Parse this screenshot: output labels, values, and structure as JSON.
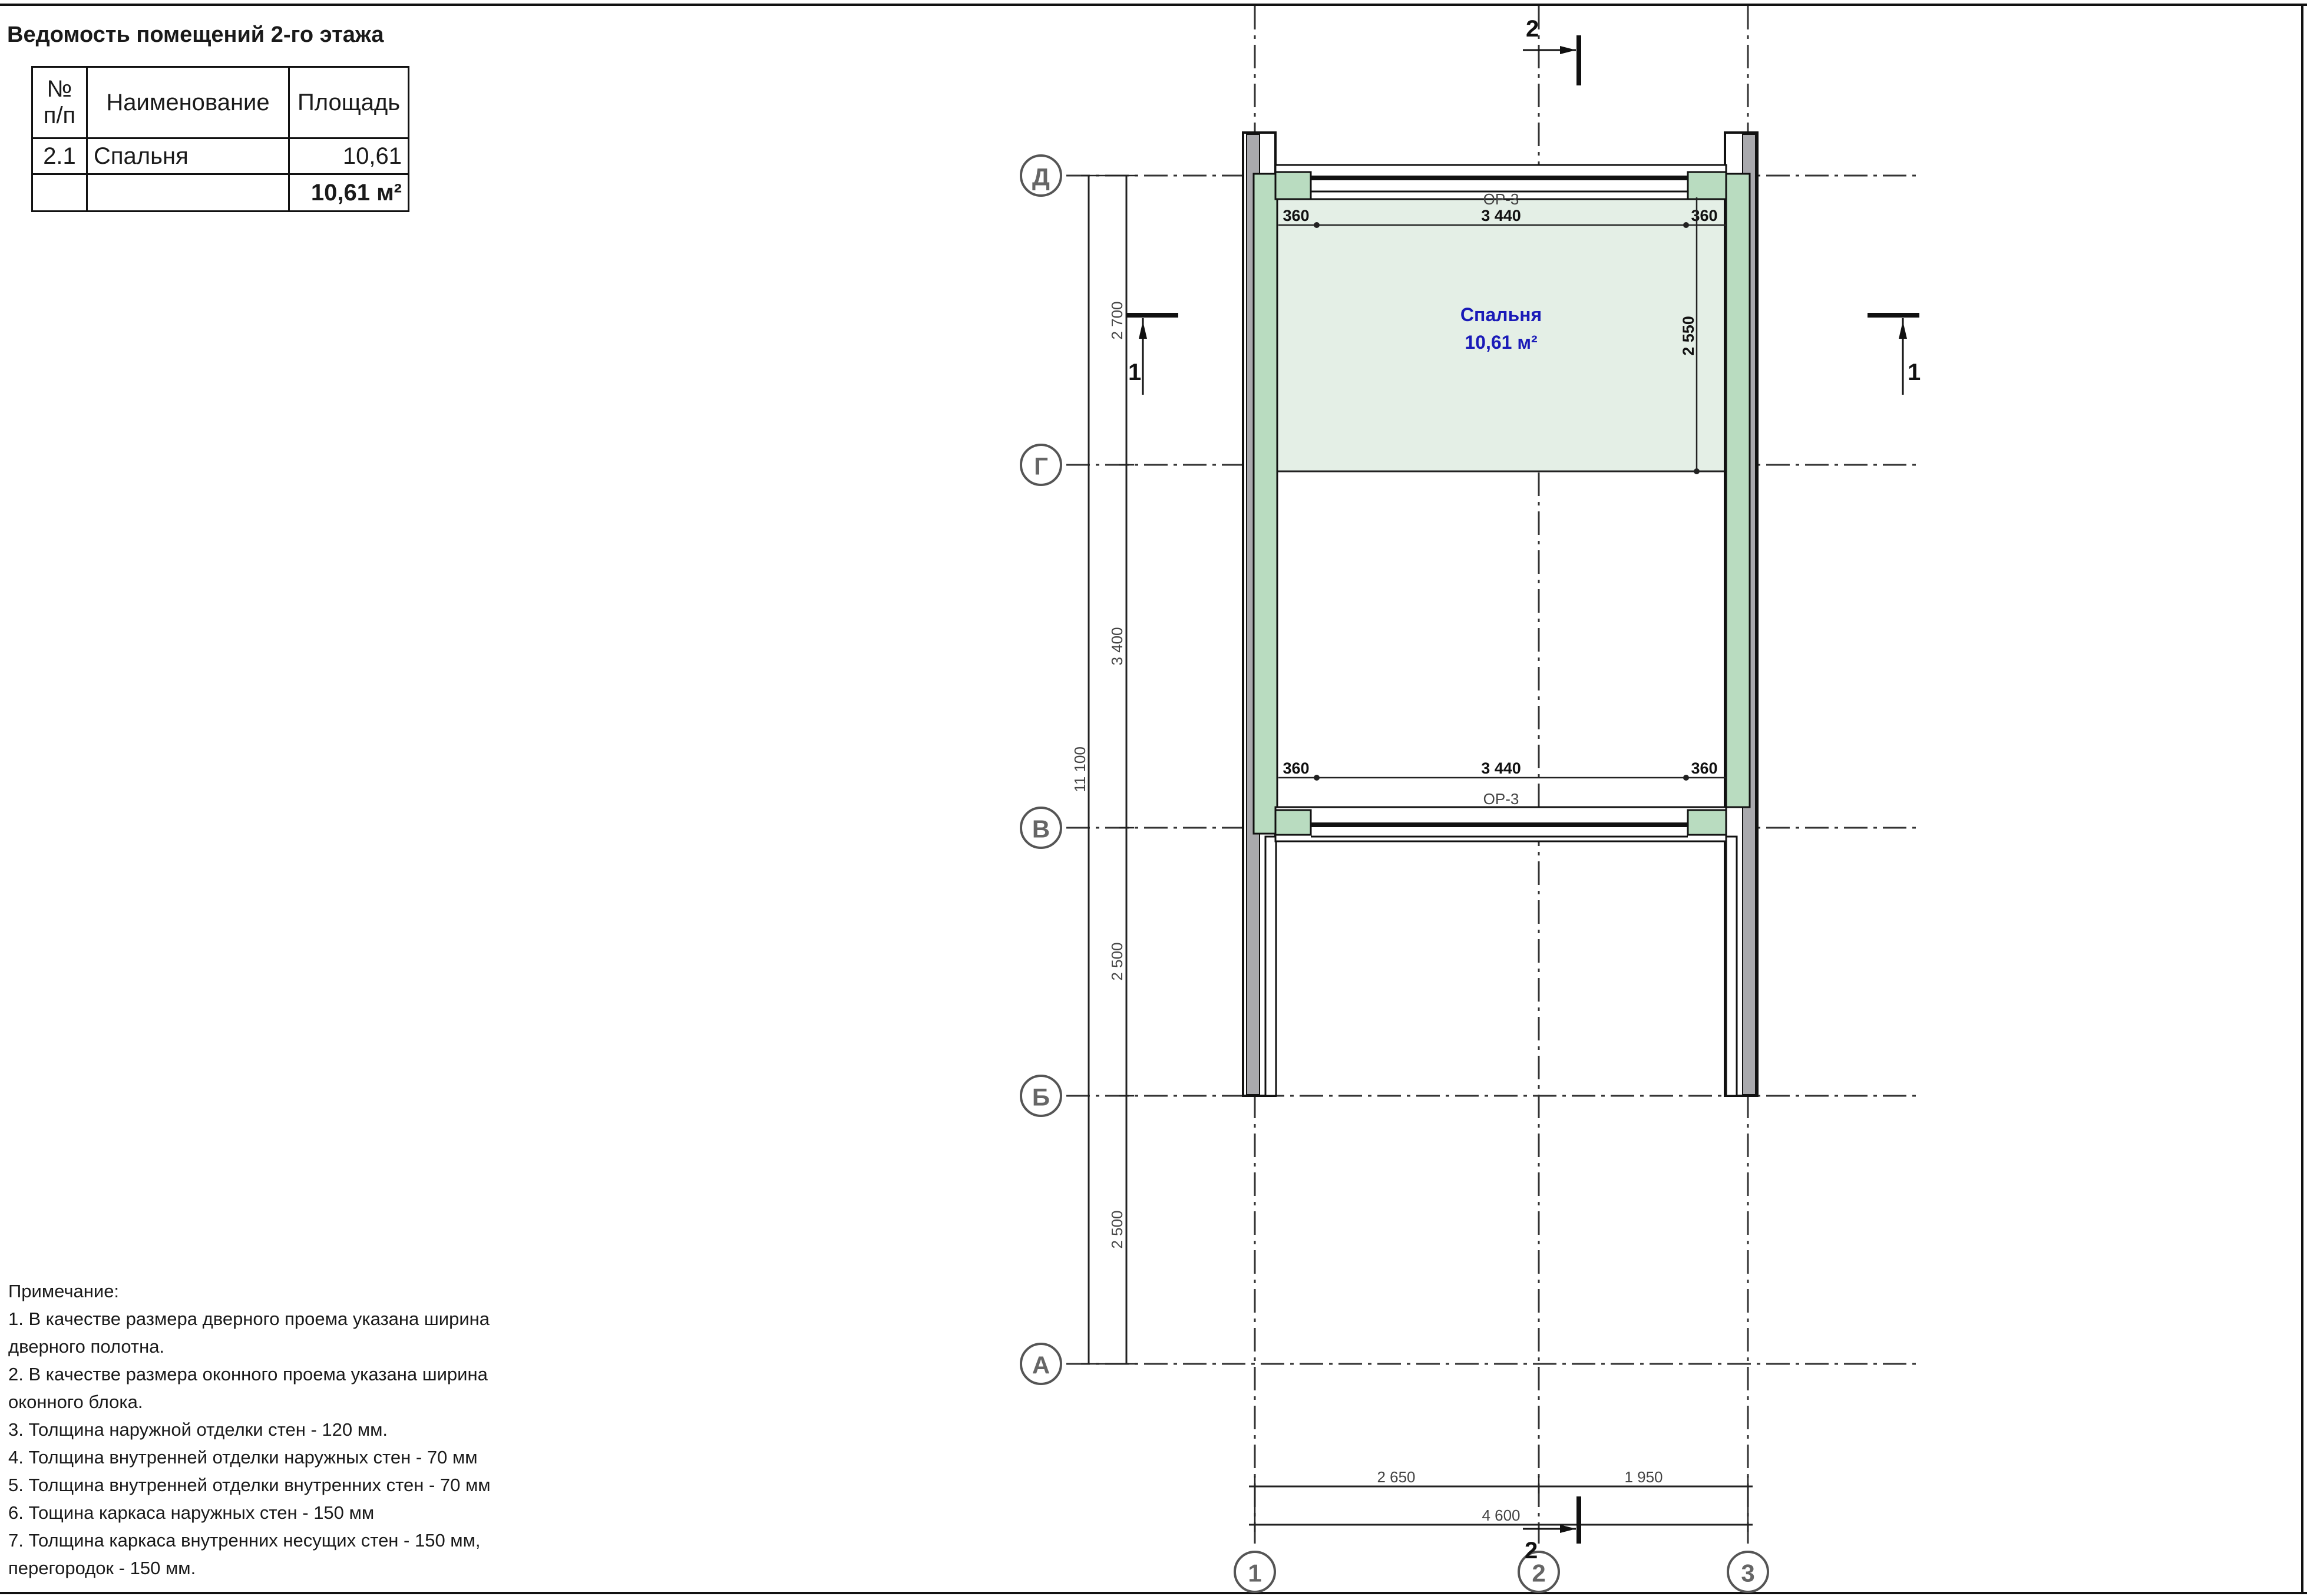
{
  "sheet": {
    "title": "Ведомость помещений 2-го этажа"
  },
  "room_table": {
    "headers": [
      "№ п/п",
      "Наименование",
      "Площадь"
    ],
    "header_no_line1": "№",
    "header_no_line2": "п/п",
    "rows": [
      {
        "no": "2.1",
        "name": "Спальня",
        "area": "10,61"
      }
    ],
    "total": "10,61 м²"
  },
  "notes": {
    "title": "Примечание:",
    "lines": [
      "1. В качестве размера дверного проема указана ширина",
      "дверного полотна.",
      "2. В качестве размера оконного проема указана ширина",
      "оконного блока.",
      "3. Толщина наружной отделки стен - 120 мм.",
      "4. Толщина внутренней отделки наружных стен - 70 мм",
      "5. Толщина внутренней отделки внутренних стен - 70 мм",
      "6. Тощина каркаса наружных стен - 150 мм",
      "7. Толщина каркаса внутренних несущих стен - 150 мм,",
      "перегородок - 150 мм."
    ]
  },
  "plan": {
    "grid_rows": [
      "Д",
      "Г",
      "В",
      "Б",
      "А"
    ],
    "grid_cols": [
      "1",
      "2",
      "3"
    ],
    "room_name": "Спальня",
    "room_area": "10,61 м²",
    "window_top": "ОР-3",
    "window_bottom": "ОР-3",
    "dim_top_left": "360",
    "dim_top_mid": "3 440",
    "dim_top_right": "360",
    "dim_bot_left": "360",
    "dim_bot_mid": "3 440",
    "dim_bot_right": "360",
    "dim_room_height": "2 550",
    "dim_left_1": "2 700",
    "dim_left_2": "3 400",
    "dim_left_3": "2 500",
    "dim_left_4": "2 500",
    "dim_left_total": "11 100",
    "dim_bottom_1": "2 650",
    "dim_bottom_2": "1 950",
    "dim_bottom_total": "4 600",
    "section_1": "1",
    "section_2": "2"
  },
  "colors": {
    "room_fill": "#e4efe6",
    "wall_finish": "#b9dcc0",
    "wall_core": "#a9a9ad",
    "room_label": "#1a1ab8",
    "line": "#1a1a1a"
  }
}
